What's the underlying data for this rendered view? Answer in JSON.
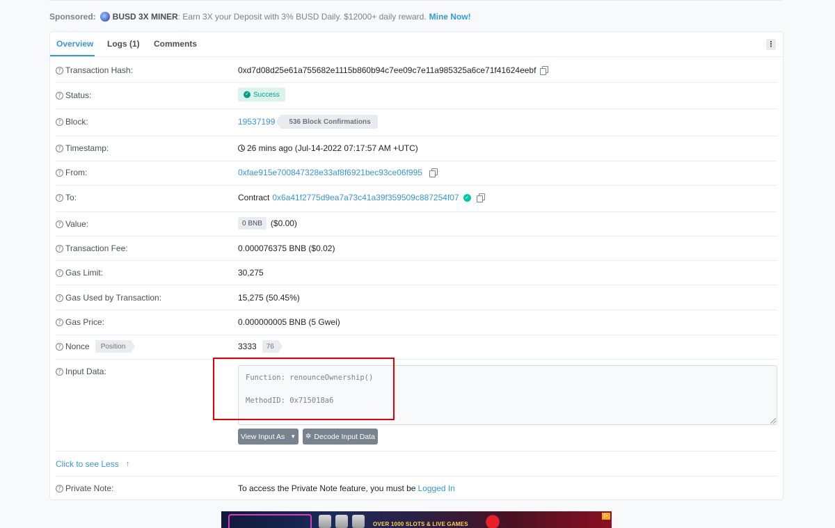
{
  "sponsor": {
    "label": "Sponsored:",
    "name": "BUSD 3X MINER",
    "text": ": Earn 3X your Deposit with 3% BUSD Daily. $12000+ daily reward.",
    "cta": "Mine Now!"
  },
  "tabs": [
    {
      "label": "Overview",
      "active": true
    },
    {
      "label": "Logs (1)",
      "active": false
    },
    {
      "label": "Comments",
      "active": false
    }
  ],
  "menu_icon": "kebab-menu-icon",
  "fields": {
    "tx_hash": {
      "label": "Transaction Hash:",
      "value": "0xd7d08d25e61a755682e1115b860b94c7ee09c7e11a985325a6ce71f41624eebf"
    },
    "status": {
      "label": "Status:",
      "value": "Success"
    },
    "block": {
      "label": "Block:",
      "value": "19537199",
      "confirmations": "536 Block Confirmations"
    },
    "timestamp": {
      "label": "Timestamp:",
      "value": "26 mins ago (Jul-14-2022 07:17:57 AM +UTC)"
    },
    "from": {
      "label": "From:",
      "value": "0xfae915e700847328e33af8f6921bec93ce06f995"
    },
    "to": {
      "label": "To:",
      "prefix": "Contract",
      "value": "0x6a41f2775d9ea7a73c41a39f359509c887254f07"
    },
    "value": {
      "label": "Value:",
      "badge": "0 BNB",
      "usd": "($0.00)"
    },
    "fee": {
      "label": "Transaction Fee:",
      "value": "0.000076375 BNB ($0.02)"
    },
    "gas_limit": {
      "label": "Gas Limit:",
      "value": "30,275"
    },
    "gas_used": {
      "label": "Gas Used by Transaction:",
      "value": "15,275 (50.45%)"
    },
    "gas_price": {
      "label": "Gas Price:",
      "value": "0.000000005 BNB (5 Gwei)"
    },
    "nonce": {
      "label": "Nonce",
      "position_label": "Position",
      "value": "3333",
      "position": "76"
    },
    "input_data": {
      "label": "Input Data:",
      "function_line": "Function: renounceOwnership()",
      "method_line": "MethodID: 0x715018a6"
    },
    "private_note": {
      "label": "Private Note:",
      "text": "To access the Private Note feature, you must be",
      "link": "Logged In"
    }
  },
  "buttons": {
    "view_input": "View Input As",
    "decode_input": "Decode Input Data"
  },
  "see_less": "Click to see Less",
  "ad": {
    "text": "OVER 1000 SLOTS & LIVE GAMES"
  },
  "colors": {
    "accent": "#3498db",
    "success": "#00a186",
    "highlight": "#e00000"
  }
}
